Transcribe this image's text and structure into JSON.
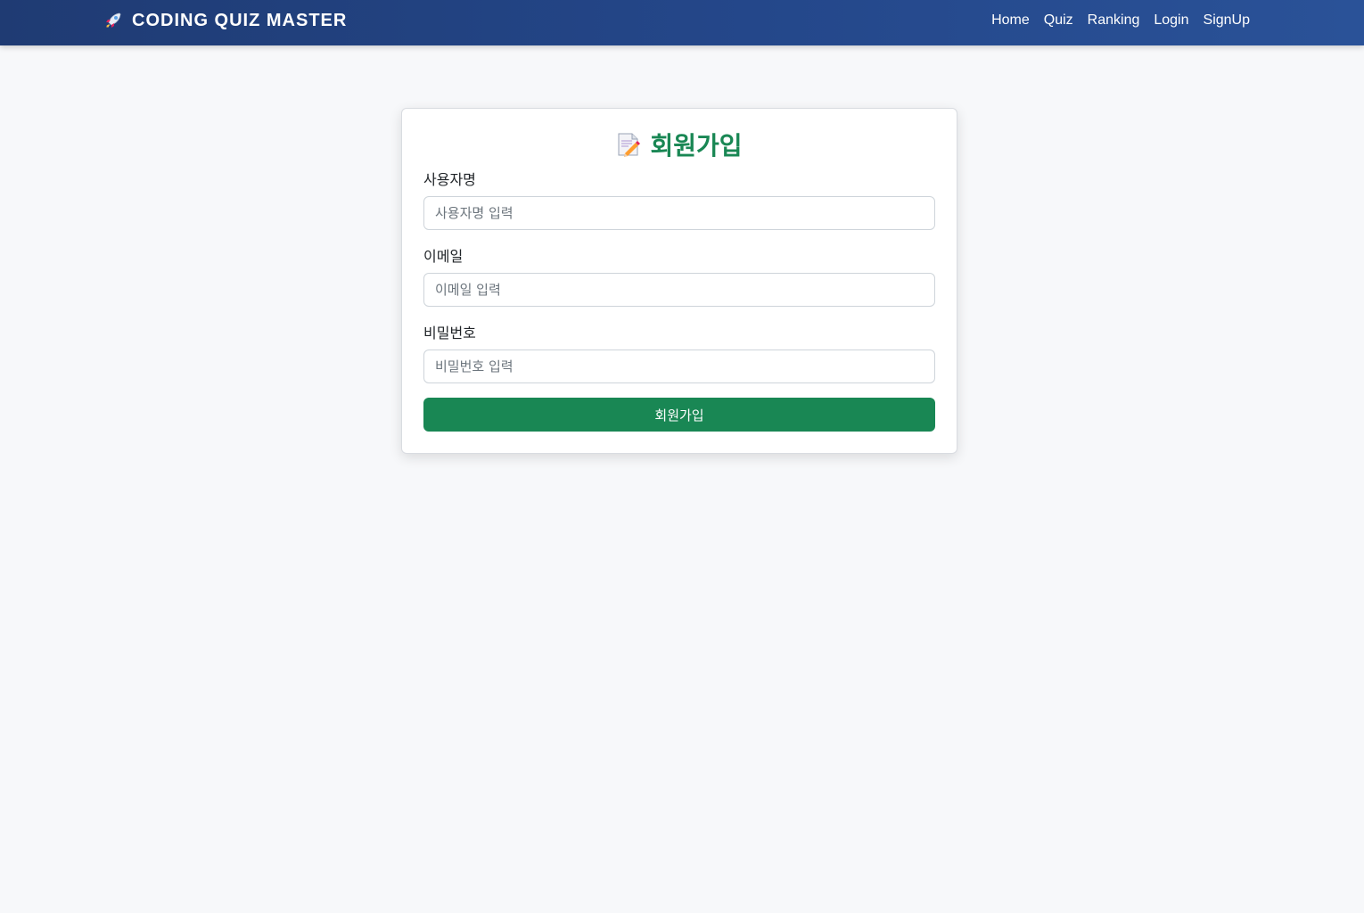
{
  "navbar": {
    "brand_text": "CODING QUIZ MASTER",
    "brand_icon": "rocket-icon",
    "links": [
      {
        "label": "Home"
      },
      {
        "label": "Quiz"
      },
      {
        "label": "Ranking"
      },
      {
        "label": "Login"
      },
      {
        "label": "SignUp"
      }
    ]
  },
  "signup": {
    "title": "회원가입",
    "title_icon": "memo-pencil-icon",
    "username": {
      "label": "사용자명",
      "placeholder": "사용자명 입력",
      "value": ""
    },
    "email": {
      "label": "이메일",
      "placeholder": "이메일 입력",
      "value": ""
    },
    "password": {
      "label": "비밀번호",
      "placeholder": "비밀번호 입력",
      "value": ""
    },
    "submit_label": "회원가입"
  },
  "colors": {
    "navbar_start": "#1f3b73",
    "navbar_end": "#2a5298",
    "accent_green": "#198754",
    "page_background": "#f7f8fa"
  }
}
